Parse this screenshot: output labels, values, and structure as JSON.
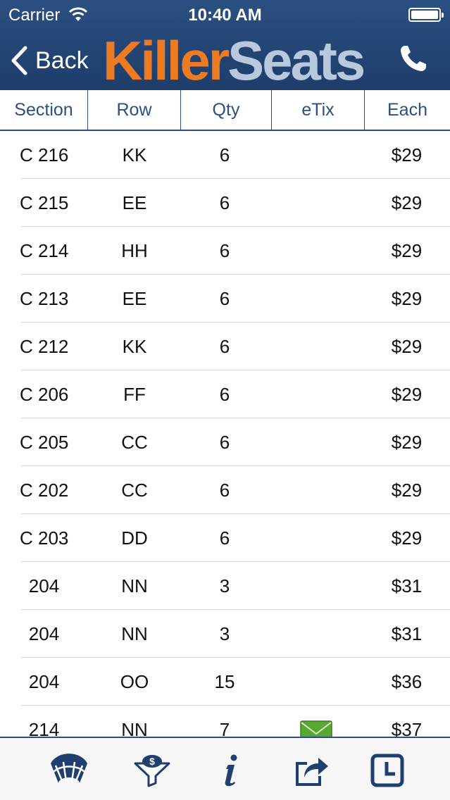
{
  "status_bar": {
    "carrier": "Carrier",
    "time": "10:40 AM"
  },
  "nav": {
    "back_label": "Back",
    "logo_part1": "Killer",
    "logo_part2": "Seats"
  },
  "columns": [
    "Section",
    "Row",
    "Qty",
    "eTix",
    "Each"
  ],
  "listings": [
    {
      "section": "C 216",
      "row": "KK",
      "qty": "6",
      "etix": false,
      "each": "$29"
    },
    {
      "section": "C 215",
      "row": "EE",
      "qty": "6",
      "etix": false,
      "each": "$29"
    },
    {
      "section": "C 214",
      "row": "HH",
      "qty": "6",
      "etix": false,
      "each": "$29"
    },
    {
      "section": "C 213",
      "row": "EE",
      "qty": "6",
      "etix": false,
      "each": "$29"
    },
    {
      "section": "C 212",
      "row": "KK",
      "qty": "6",
      "etix": false,
      "each": "$29"
    },
    {
      "section": "C 206",
      "row": "FF",
      "qty": "6",
      "etix": false,
      "each": "$29"
    },
    {
      "section": "C 205",
      "row": "CC",
      "qty": "6",
      "etix": false,
      "each": "$29"
    },
    {
      "section": "C 202",
      "row": "CC",
      "qty": "6",
      "etix": false,
      "each": "$29"
    },
    {
      "section": "C 203",
      "row": "DD",
      "qty": "6",
      "etix": false,
      "each": "$29"
    },
    {
      "section": "204",
      "row": "NN",
      "qty": "3",
      "etix": false,
      "each": "$31"
    },
    {
      "section": "204",
      "row": "NN",
      "qty": "3",
      "etix": false,
      "each": "$31"
    },
    {
      "section": "204",
      "row": "OO",
      "qty": "15",
      "etix": false,
      "each": "$36"
    },
    {
      "section": "214",
      "row": "NN",
      "qty": "7",
      "etix": true,
      "each": "$37"
    }
  ],
  "tabs": [
    {
      "icon": "stadium-seats-icon"
    },
    {
      "icon": "price-filter-icon"
    },
    {
      "icon": "info-icon"
    },
    {
      "icon": "share-icon"
    },
    {
      "icon": "clock-icon"
    }
  ],
  "colors": {
    "primary": "#2b4f80",
    "brand_orange": "#ee7a22",
    "brand_light": "#b8c9de",
    "etix_green": "#5aa832"
  }
}
